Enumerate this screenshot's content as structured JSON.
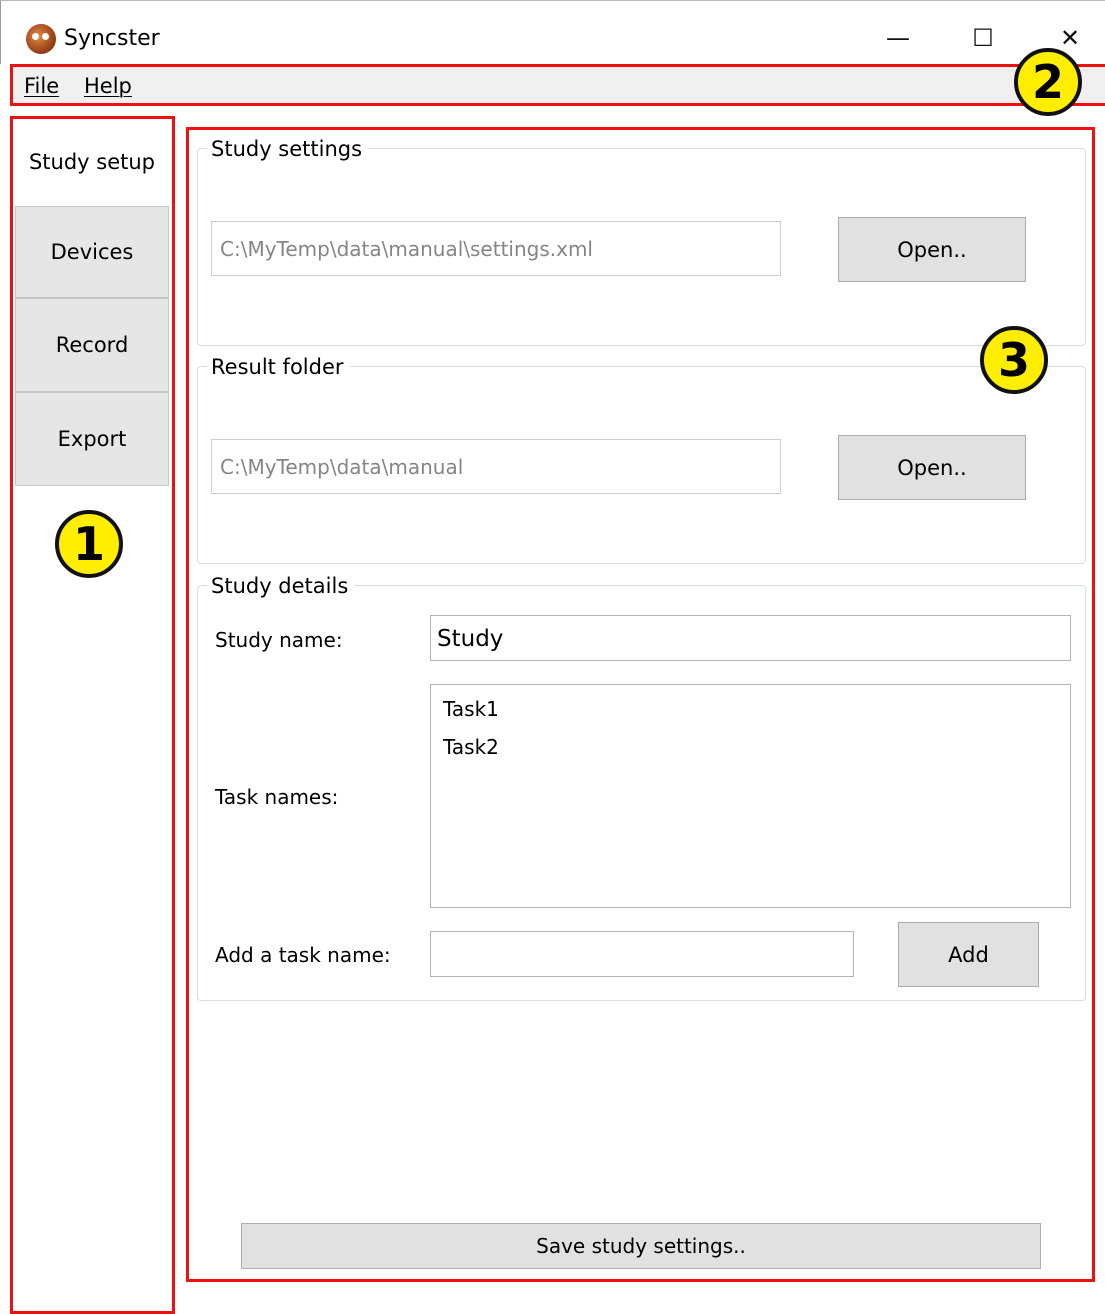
{
  "window": {
    "title": "Syncster",
    "controls": {
      "minimize_icon": "—",
      "maximize_icon": "☐",
      "close_icon": "✕"
    }
  },
  "menu": {
    "file": "File",
    "help": "Help"
  },
  "sidebar": {
    "tabs": [
      {
        "label": "Study setup",
        "active": true
      },
      {
        "label": "Devices"
      },
      {
        "label": "Record"
      },
      {
        "label": "Export"
      }
    ]
  },
  "markers": {
    "sidebar": "1",
    "menu": "2",
    "content": "3"
  },
  "study_settings": {
    "title": "Study settings",
    "path": "C:\\MyTemp\\data\\manual\\settings.xml",
    "open_label": "Open.."
  },
  "result_folder": {
    "title": "Result folder",
    "path": "C:\\MyTemp\\data\\manual",
    "open_label": "Open.."
  },
  "study_details": {
    "title": "Study details",
    "study_name_label": "Study name:",
    "study_name_value": "Study",
    "task_names_label": "Task names:",
    "tasks": [
      "Task1",
      "Task2"
    ],
    "add_task_label": "Add a task name:",
    "add_task_value": "",
    "add_button": "Add"
  },
  "save_button": "Save study settings..",
  "colors": {
    "annotation": "#ee1111",
    "marker": "#ffee00"
  }
}
